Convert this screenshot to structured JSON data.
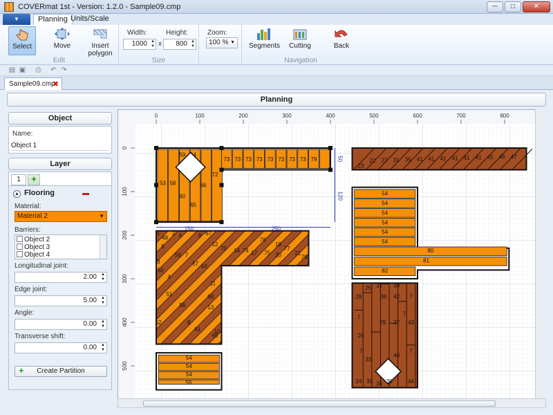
{
  "window": {
    "title": "COVERmat 1st - Version: 1.2.0 - Sample09.cmp",
    "minimize": "─",
    "maximize": "□",
    "close": "✕"
  },
  "ribbon_tabs": [
    "Planning",
    "Units/Scale"
  ],
  "ribbon": {
    "edit": {
      "label": "Edit",
      "select": "Select",
      "move": "Move",
      "insert_polygon": "Insert polygon"
    },
    "size": {
      "label": "Size",
      "width_label": "Width:",
      "width_value": "1000",
      "height_label": "Height:",
      "height_value": "800",
      "times": "x"
    },
    "zoom": {
      "label": "Zoom:",
      "value": "100 %"
    },
    "navigation": {
      "label": "Navigation",
      "segments": "Segments",
      "cutting": "Cutting",
      "back": "Back"
    }
  },
  "document_tab": {
    "name": "Sample09.cmp"
  },
  "planning_header": "Planning",
  "left_panel": {
    "object_header": "Object",
    "name_label": "Name:",
    "name_value": "Object 1",
    "layer_header": "Layer",
    "layer_tab": "1",
    "flooring_title": "Flooring",
    "material_label": "Material:",
    "material_value": "Material 2",
    "barriers_label": "Barriers:",
    "barriers": [
      "Object 2",
      "Object 3",
      "Object 4"
    ],
    "longitudinal_label": "Longitudinal joint:",
    "longitudinal_value": "2.00",
    "edge_label": "Edge joint:",
    "edge_value": "5.00",
    "angle_label": "Angle:",
    "angle_value": "0.00",
    "transverse_label": "Transverse shift:",
    "transverse_value": "0.00",
    "create_partition": "Create Partition"
  },
  "ruler": {
    "x_ticks": [
      "0",
      "100",
      "200",
      "300",
      "400",
      "500",
      "600",
      "700",
      "800"
    ],
    "y_ticks": [
      "0",
      "100",
      "200",
      "300",
      "400",
      "500"
    ]
  },
  "colors": {
    "plank_orange": "#f5900a",
    "plank_brown": "#a24d22",
    "material_highlight": "#fb8c00",
    "dimension": "#2233aa",
    "grid": "#dfe3e8"
  },
  "plan": {
    "dimensions": [
      "150",
      "250",
      "50",
      "120"
    ],
    "main_plank_numbers": [
      "53",
      "58",
      "59",
      "64",
      "60",
      "65",
      "66",
      "72",
      "73",
      "73",
      "73",
      "73",
      "73",
      "73",
      "73",
      "73",
      "79"
    ],
    "brown_top_numbers": [
      "23",
      "22",
      "27",
      "31",
      "35",
      "41",
      "41",
      "41",
      "41",
      "41",
      "41",
      "45",
      "46",
      "47"
    ],
    "right_strip_numbers": [
      "54",
      "54",
      "54",
      "54",
      "54",
      "54",
      "80",
      "81",
      "82"
    ],
    "diag_numbers": [
      "1",
      "48",
      "2",
      "4",
      "9",
      "67",
      "12",
      "5",
      "56",
      "7",
      "3",
      "50",
      "57",
      "63",
      "4",
      "11",
      "51",
      "68",
      "56",
      "13",
      "52",
      "8",
      "61",
      "10",
      "69",
      "70",
      "14",
      "74",
      "17",
      "76",
      "75",
      "19",
      "20",
      "77",
      "21",
      "78"
    ],
    "bottom_left_numbers": [
      "54",
      "54",
      "54",
      "55"
    ],
    "bottom_right_numbers": [
      "25",
      "32",
      "39",
      "7",
      "28",
      "36",
      "42",
      "7",
      "29",
      "37",
      "43",
      "26",
      "33",
      "40",
      "24",
      "30",
      "34",
      "38",
      "44",
      "7",
      "7",
      "7"
    ]
  }
}
